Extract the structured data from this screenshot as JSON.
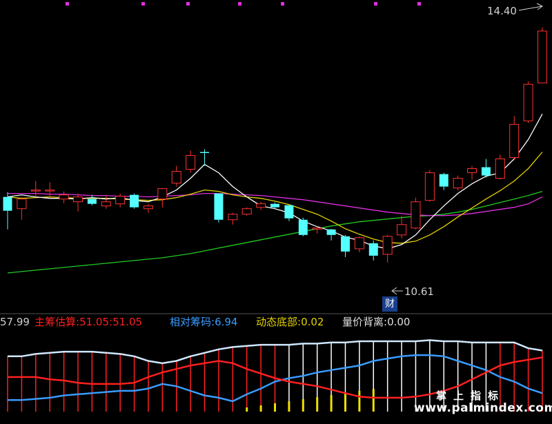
{
  "chart_data": [
    {
      "type": "candlestick",
      "title": "",
      "high_annotation": "14.40",
      "low_annotation": "10.61",
      "event_badge": "财",
      "colors": {
        "up": "#ff3232",
        "down": "#54ffff",
        "ma1": "#ffffff",
        "ma2": "#e6d200",
        "ma3": "#e030e0",
        "ma4": "#22cc22"
      },
      "candles": [
        {
          "o": 11.95,
          "h": 12.02,
          "l": 11.48,
          "c": 11.75
        },
        {
          "o": 11.78,
          "h": 11.95,
          "l": 11.62,
          "c": 11.92
        },
        {
          "o": 12.05,
          "h": 12.18,
          "l": 11.95,
          "c": 12.05
        },
        {
          "o": 12.05,
          "h": 12.16,
          "l": 11.95,
          "c": 12.05
        },
        {
          "o": 11.92,
          "h": 12.03,
          "l": 11.86,
          "c": 11.98
        },
        {
          "o": 11.88,
          "h": 12.0,
          "l": 11.74,
          "c": 11.95
        },
        {
          "o": 11.92,
          "h": 11.98,
          "l": 11.83,
          "c": 11.85
        },
        {
          "o": 11.82,
          "h": 11.98,
          "l": 11.78,
          "c": 11.88
        },
        {
          "o": 11.85,
          "h": 12.0,
          "l": 11.8,
          "c": 11.96
        },
        {
          "o": 11.98,
          "h": 12.0,
          "l": 11.78,
          "c": 11.8
        },
        {
          "o": 11.78,
          "h": 11.85,
          "l": 11.72,
          "c": 11.82
        },
        {
          "o": 11.92,
          "h": 12.08,
          "l": 11.8,
          "c": 12.07
        },
        {
          "o": 12.15,
          "h": 12.4,
          "l": 12.1,
          "c": 12.32
        },
        {
          "o": 12.35,
          "h": 12.62,
          "l": 12.3,
          "c": 12.55
        },
        {
          "o": 12.6,
          "h": 12.64,
          "l": 12.4,
          "c": 12.59
        },
        {
          "o": 12.0,
          "h": 12.0,
          "l": 11.58,
          "c": 11.62
        },
        {
          "o": 11.62,
          "h": 11.72,
          "l": 11.55,
          "c": 11.7
        },
        {
          "o": 11.7,
          "h": 11.8,
          "l": 11.68,
          "c": 11.78
        },
        {
          "o": 11.8,
          "h": 11.88,
          "l": 11.76,
          "c": 11.85
        },
        {
          "o": 11.85,
          "h": 11.87,
          "l": 11.78,
          "c": 11.8
        },
        {
          "o": 11.83,
          "h": 11.83,
          "l": 11.6,
          "c": 11.64
        },
        {
          "o": 11.62,
          "h": 11.65,
          "l": 11.38,
          "c": 11.4
        },
        {
          "o": 11.5,
          "h": 11.52,
          "l": 11.42,
          "c": 11.5
        },
        {
          "o": 11.48,
          "h": 11.49,
          "l": 11.32,
          "c": 11.4
        },
        {
          "o": 11.38,
          "h": 11.4,
          "l": 11.08,
          "c": 11.16
        },
        {
          "o": 11.2,
          "h": 11.38,
          "l": 11.15,
          "c": 11.36
        },
        {
          "o": 11.28,
          "h": 11.32,
          "l": 11.03,
          "c": 11.1
        },
        {
          "o": 11.12,
          "h": 11.4,
          "l": 11.0,
          "c": 11.38
        },
        {
          "o": 11.4,
          "h": 11.68,
          "l": 11.35,
          "c": 11.55
        },
        {
          "o": 11.5,
          "h": 11.94,
          "l": 11.48,
          "c": 11.88
        },
        {
          "o": 11.9,
          "h": 12.34,
          "l": 11.88,
          "c": 12.3
        },
        {
          "o": 12.28,
          "h": 12.3,
          "l": 12.05,
          "c": 12.1
        },
        {
          "o": 12.08,
          "h": 12.26,
          "l": 12.04,
          "c": 12.22
        },
        {
          "o": 12.3,
          "h": 12.4,
          "l": 12.2,
          "c": 12.36
        },
        {
          "o": 12.38,
          "h": 12.5,
          "l": 12.23,
          "c": 12.26
        },
        {
          "o": 12.22,
          "h": 12.56,
          "l": 12.2,
          "c": 12.5
        },
        {
          "o": 12.52,
          "h": 13.12,
          "l": 12.48,
          "c": 13.0
        },
        {
          "o": 13.05,
          "h": 13.62,
          "l": 13.02,
          "c": 13.58
        },
        {
          "o": 13.6,
          "h": 14.4,
          "l": 13.6,
          "c": 14.35
        }
      ],
      "ma1": [
        11.95,
        11.98,
        11.95,
        11.93,
        11.93,
        11.92,
        11.94,
        11.92,
        11.94,
        11.9,
        11.88,
        11.95,
        12.05,
        12.22,
        12.42,
        12.3,
        12.1,
        11.95,
        11.82,
        11.78,
        11.72,
        11.6,
        11.52,
        11.46,
        11.37,
        11.32,
        11.24,
        11.2,
        11.26,
        11.4,
        11.62,
        11.82,
        12.0,
        12.14,
        12.25,
        12.3,
        12.5,
        12.78,
        13.15
      ],
      "ma2": [
        11.95,
        11.93,
        11.94,
        11.95,
        11.94,
        11.93,
        11.93,
        11.93,
        11.92,
        11.91,
        11.9,
        11.91,
        11.94,
        11.99,
        12.05,
        12.03,
        11.98,
        11.95,
        11.93,
        11.89,
        11.84,
        11.77,
        11.7,
        11.6,
        11.49,
        11.41,
        11.34,
        11.29,
        11.28,
        11.31,
        11.4,
        11.52,
        11.66,
        11.79,
        11.92,
        12.04,
        12.18,
        12.36,
        12.6
      ],
      "ma3": [
        12.0,
        12.0,
        12.0,
        11.99,
        11.99,
        11.98,
        11.97,
        11.97,
        11.96,
        11.96,
        11.95,
        11.96,
        11.97,
        11.98,
        12.0,
        12.0,
        11.99,
        11.98,
        11.97,
        11.95,
        11.93,
        11.91,
        11.88,
        11.85,
        11.82,
        11.79,
        11.76,
        11.73,
        11.71,
        11.69,
        11.68,
        11.68,
        11.69,
        11.71,
        11.74,
        11.77,
        11.8,
        11.85,
        11.95
      ],
      "ma4": [
        10.85,
        10.87,
        10.89,
        10.91,
        10.93,
        10.95,
        10.97,
        10.99,
        11.01,
        11.03,
        11.05,
        11.07,
        11.1,
        11.13,
        11.17,
        11.21,
        11.25,
        11.29,
        11.33,
        11.37,
        11.41,
        11.45,
        11.49,
        11.53,
        11.56,
        11.59,
        11.61,
        11.63,
        11.65,
        11.67,
        11.68,
        11.7,
        11.73,
        11.77,
        11.82,
        11.87,
        11.92,
        11.97,
        12.03
      ]
    },
    {
      "type": "line",
      "title": "",
      "legend": [
        {
          "name": "",
          "value": "57.99",
          "color": "#d0d0d0"
        },
        {
          "name": "主筹估算",
          "value": "51.05",
          "value2": "51.05",
          "color": "#ff2020"
        },
        {
          "name": "相对筹码",
          "value": "6.94",
          "color": "#3a9cff"
        },
        {
          "name": "动态底部",
          "value": "0.02",
          "color": "#e6d200"
        },
        {
          "name": "量价背离",
          "value": "0.00",
          "color": "#e0e0e0"
        }
      ],
      "series": [
        {
          "name": "相对筹码",
          "color": "#3a9cff",
          "values": [
            10,
            10,
            11,
            12,
            14,
            15,
            16,
            17,
            18,
            18,
            20,
            24,
            22,
            18,
            14,
            12,
            9,
            15,
            20,
            26,
            29,
            31,
            34,
            36,
            38,
            40,
            44,
            46,
            48,
            49,
            49,
            48,
            44,
            40,
            36,
            30,
            26,
            20,
            16
          ]
        },
        {
          "name": "主筹估算",
          "color": "#ff2020",
          "values": [
            30,
            30,
            30,
            28,
            27,
            25,
            24,
            24,
            24,
            25,
            30,
            34,
            37,
            40,
            42,
            44,
            42,
            37,
            33,
            29,
            26,
            24,
            22,
            19,
            16,
            13,
            12,
            12,
            12,
            13,
            15,
            18,
            22,
            28,
            34,
            40,
            43,
            45,
            47
          ]
        },
        {
          "name": "",
          "color": "#d0e8ff",
          "values": [
            48,
            48,
            50,
            51,
            52,
            52,
            52,
            51,
            50,
            48,
            44,
            42,
            44,
            48,
            51,
            54,
            56,
            57,
            58,
            58,
            58,
            59,
            59,
            60,
            60,
            61,
            61,
            61,
            61,
            61,
            62,
            61,
            61,
            60,
            60,
            60,
            60,
            55,
            53
          ]
        }
      ],
      "ylim": [
        0,
        70
      ]
    }
  ],
  "watermark": {
    "cn": "掌上指标",
    "url": "www.palmindex.com"
  }
}
